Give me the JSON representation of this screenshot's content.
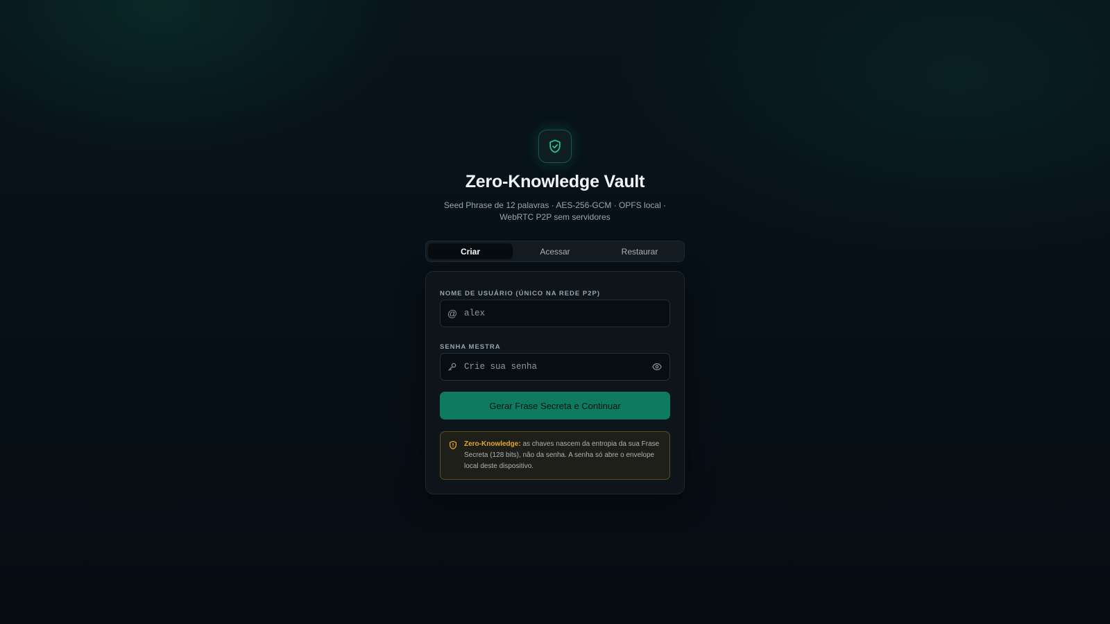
{
  "app": {
    "title": "Zero-Knowledge Vault",
    "subtitle": "Seed Phrase de 12 palavras · AES-256-GCM · OPFS local · WebRTC P2P sem servidores",
    "logo_icon": "shield-check-icon",
    "accent_color": "#22c59a"
  },
  "tabs": [
    {
      "label": "Criar",
      "active": true
    },
    {
      "label": "Acessar",
      "active": false
    },
    {
      "label": "Restaurar",
      "active": false
    }
  ],
  "form": {
    "username": {
      "label": "Nome de usuário (único na rede P2P)",
      "icon": "at-icon",
      "icon_glyph": "@",
      "value": "",
      "placeholder": "alex"
    },
    "password": {
      "label": "Senha mestra",
      "icon": "key-icon",
      "value": "",
      "placeholder": "Crie sua senha",
      "toggle_icon": "eye-icon"
    },
    "submit_label": "Gerar Frase Secreta e Continuar",
    "submit_color": "#0e7a5f"
  },
  "notice": {
    "icon": "shield-alert-icon",
    "strong": "Zero-Knowledge:",
    "text": " as chaves nascem da entropia da sua Frase Secreta (128 bits), não da senha. A senha só abre o envelope local deste dispositivo.",
    "color": "#e3a72b"
  }
}
